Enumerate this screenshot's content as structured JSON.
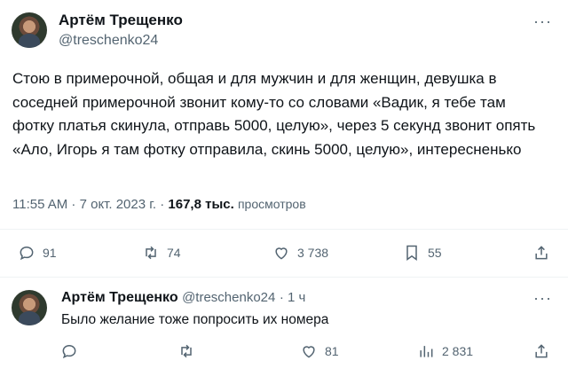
{
  "tweet": {
    "author_name": "Артём Трещенко",
    "author_handle": "@treschenko24",
    "text": "Стою в примерочной, общая и для мужчин и для женщин, девушка в соседней примерочной звонит кому-то со словами «Вадик, я тебе там фотку платья скинула, отправь 5000, целую», через 5 секунд звонит опять «Ало, Игорь я там фотку отправила, скинь 5000, целую», интересненько",
    "time": "11:55 AM · 7 окт. 2023 г. ·",
    "views_count": "167,8 тыс.",
    "views_label": "просмотров",
    "more_icon": "···",
    "actions": {
      "replies": "91",
      "retweets": "74",
      "likes": "3 738",
      "bookmarks": "55"
    }
  },
  "reply": {
    "author_name": "Артём Трещенко",
    "author_handle": "@treschenko24",
    "time": "· 1 ч",
    "text": "Было желание тоже попросить их номера",
    "more_icon": "···",
    "actions": {
      "replies": "",
      "retweets": "",
      "likes": "81",
      "views": "2 831"
    }
  }
}
